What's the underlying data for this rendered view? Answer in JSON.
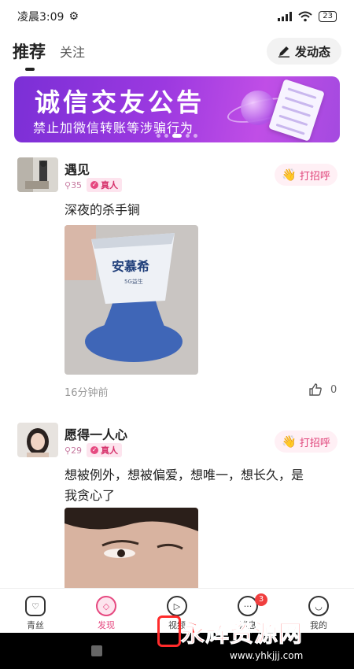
{
  "status_bar": {
    "time": "凌晨3:09",
    "battery": "23"
  },
  "tabs": {
    "active": "推荐",
    "other": "关注",
    "post_button": "发动态"
  },
  "banner": {
    "title": "诚信交友公告",
    "subtitle": "禁止加微信转账等涉骗行为"
  },
  "posts": [
    {
      "name": "遇见",
      "count": "35",
      "badge": "真人",
      "greet": "打招呼",
      "text": "深夜的杀手锏",
      "photo_label": "安慕希",
      "photo_sublabel": "5G益生",
      "time_ago": "16分钟前",
      "likes": "0"
    },
    {
      "name": "愿得一人心",
      "count": "29",
      "badge": "真人",
      "greet": "打招呼",
      "text_line1": "想被例外，想被偏爱，想唯一，想长久，是",
      "text_line2": "我贪心了"
    }
  ],
  "nav": [
    {
      "label": "青丝",
      "icon": "heart-icon"
    },
    {
      "label": "发现",
      "icon": "leaf-icon"
    },
    {
      "label": "视频",
      "icon": "play-icon"
    },
    {
      "label": "消息",
      "icon": "chat-icon",
      "badge": "3"
    },
    {
      "label": "我的",
      "icon": "smile-icon"
    }
  ],
  "watermark": {
    "text": "永辉资源网",
    "url": "www.yhkjjj.com"
  },
  "colors": {
    "accent": "#e64980",
    "banner": "#8e35db"
  }
}
